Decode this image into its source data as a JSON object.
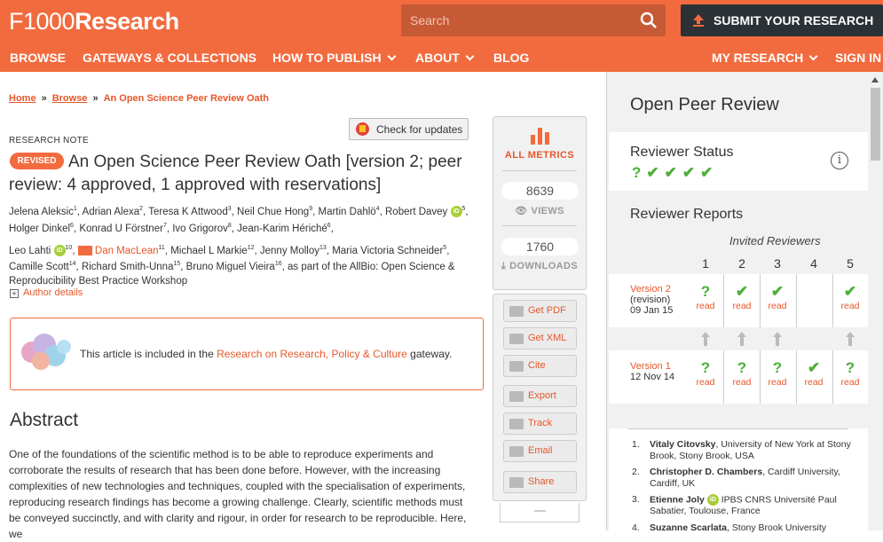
{
  "header": {
    "logo_prefix": "F1000",
    "logo_suffix": "Research",
    "search_placeholder": "Search",
    "submit_label": "SUBMIT YOUR RESEARCH",
    "nav": [
      {
        "label": "BROWSE"
      },
      {
        "label": "GATEWAYS & COLLECTIONS"
      },
      {
        "label": "HOW TO PUBLISH"
      },
      {
        "label": "ABOUT"
      },
      {
        "label": "BLOG"
      },
      {
        "label": "MY RESEARCH"
      },
      {
        "label": "SIGN IN"
      }
    ]
  },
  "breadcrumb": {
    "items": [
      "Home",
      "Browse"
    ],
    "current": "An Open Science Peer Review Oath"
  },
  "check_updates_label": "Check for updates",
  "article": {
    "type": "RESEARCH NOTE",
    "badge": "REVISED",
    "title": "An Open Science Peer Review Oath [version 2; peer review: 4 approved, 1 approved with reservations]",
    "authors": [
      {
        "name": "Jelena Aleksic",
        "sup": "1"
      },
      {
        "name": "Adrian Alexa",
        "sup": "2"
      },
      {
        "name": "Teresa K Attwood",
        "sup": "3"
      },
      {
        "name": "Neil Chue Hong",
        "sup": "9"
      },
      {
        "name": "Martin Dahlö",
        "sup": "4"
      },
      {
        "name": "Robert Davey",
        "sup": "5"
      },
      {
        "name": "Holger Dinkel",
        "sup": "6"
      },
      {
        "name": "Konrad U Förstner",
        "sup": "7"
      },
      {
        "name": "Ivo Grigorov",
        "sup": "8"
      },
      {
        "name": "Jean-Karim Hériché",
        "sup": "6"
      },
      {
        "name": "Leo Lahti",
        "sup": "10"
      },
      {
        "name": "Dan MacLean",
        "sup": "11"
      },
      {
        "name": "Michael L Markie",
        "sup": "12"
      },
      {
        "name": "Jenny Molloy",
        "sup": "13"
      },
      {
        "name": "Maria Victoria Schneider",
        "sup": "5"
      },
      {
        "name": "Camille Scott",
        "sup": "14"
      },
      {
        "name": "Richard Smith-Unna",
        "sup": "15"
      },
      {
        "name": "Bruno Miguel Vieira",
        "sup": "16"
      }
    ],
    "author_suffix": ", as part of the AllBio: Open Science & Reproducibility Best Practice Workshop",
    "author_details": "Author details",
    "gateway_pre": "This article is included in the ",
    "gateway_link": "Research on Research, Policy & Culture",
    "gateway_post": " gateway.",
    "abstract_heading": "Abstract",
    "abstract_text": "One of the foundations of the scientific method is to be able to reproduce experiments and corroborate the results of research that has been done before. However, with the increasing complexities of new technologies and techniques, coupled with the specialisation of experiments, reproducing research findings has become a growing challenge. Clearly, scientific methods must be conveyed succinctly, and with clarity and rigour, in order for research to be reproducible. Here, we"
  },
  "metrics": {
    "all_label": "ALL METRICS",
    "views": "8639",
    "views_label": "VIEWS",
    "downloads": "1760",
    "downloads_label": "DOWNLOADS"
  },
  "tools": [
    "Get PDF",
    "Get XML",
    "Cite",
    "Export",
    "Track",
    "Email",
    "Share"
  ],
  "review": {
    "heading": "Open Peer Review",
    "status_heading": "Reviewer Status",
    "status_marks": [
      "?",
      "✔",
      "✔",
      "✔",
      "✔"
    ],
    "reports_heading": "Reviewer Reports",
    "invited": "Invited Reviewers",
    "columns": [
      "1",
      "2",
      "3",
      "4",
      "5"
    ],
    "versions": [
      {
        "label": "Version 2",
        "sub": "(revision)",
        "date": "09 Jan 15",
        "cells": [
          "?",
          "✔",
          "✔",
          "",
          "✔"
        ]
      },
      {
        "label": "Version 1",
        "sub": "",
        "date": "12 Nov 14",
        "cells": [
          "?",
          "?",
          "?",
          "✔",
          "?"
        ]
      }
    ],
    "read_label": "read",
    "reviewers": [
      {
        "n": "1.",
        "name": "Vitaly Citovsky",
        "aff": ", University of New York at Stony Brook, Stony Brook, USA"
      },
      {
        "n": "2.",
        "name": "Christopher D. Chambers",
        "aff": ", Cardiff University, Cardiff, UK"
      },
      {
        "n": "3.",
        "name": "Etienne Joly",
        "aff": " IPBS CNRS Université Paul Sabatier, Toulouse, France"
      },
      {
        "n": "4.",
        "name": "Suzanne Scarlata",
        "aff": ", Stony Brook University"
      }
    ]
  },
  "colors": {
    "brand": "#f26b3f",
    "dark": "#2c3136",
    "approved": "#4caf3a"
  }
}
